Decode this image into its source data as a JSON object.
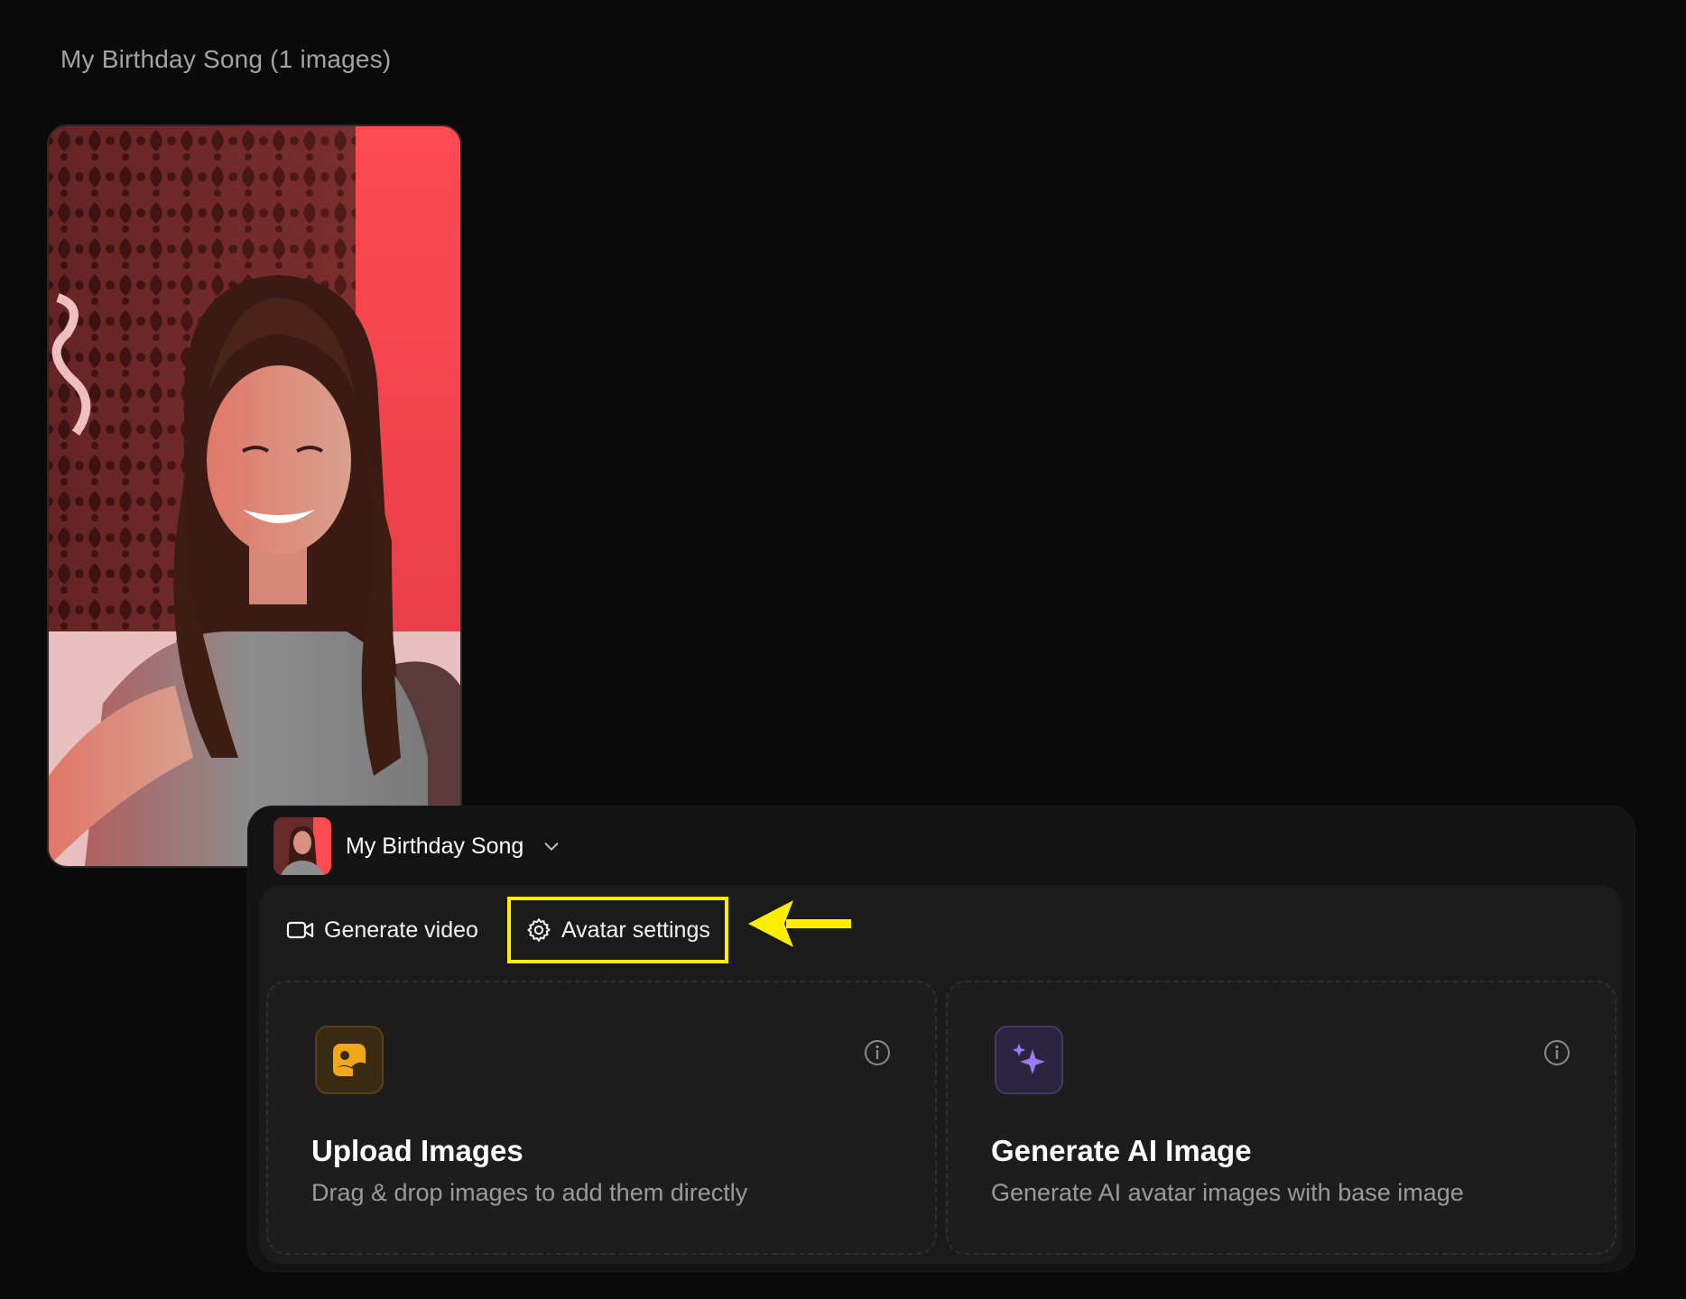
{
  "gallery": {
    "title": "My Birthday Song (1 images)"
  },
  "avatar": {
    "name": "My Birthday Song"
  },
  "toolbar": {
    "generate_video_label": "Generate video",
    "avatar_settings_label": "Avatar settings"
  },
  "cards": {
    "upload": {
      "title": "Upload Images",
      "description": "Drag & drop images to add them directly"
    },
    "ai": {
      "title": "Generate AI Image",
      "description": "Generate AI avatar images with base image"
    }
  },
  "colors": {
    "highlight": "#ffee00",
    "upload_accent": "#f0a81a",
    "ai_accent": "#9a7cf0"
  },
  "icons": {
    "generate_video": "video-camera-icon",
    "avatar_settings": "gear-icon",
    "annotation": "arrow-left-icon",
    "upload": "image-upload-icon",
    "ai": "sparkles-icon",
    "info": "info-icon",
    "dropdown": "chevron-down-icon"
  }
}
